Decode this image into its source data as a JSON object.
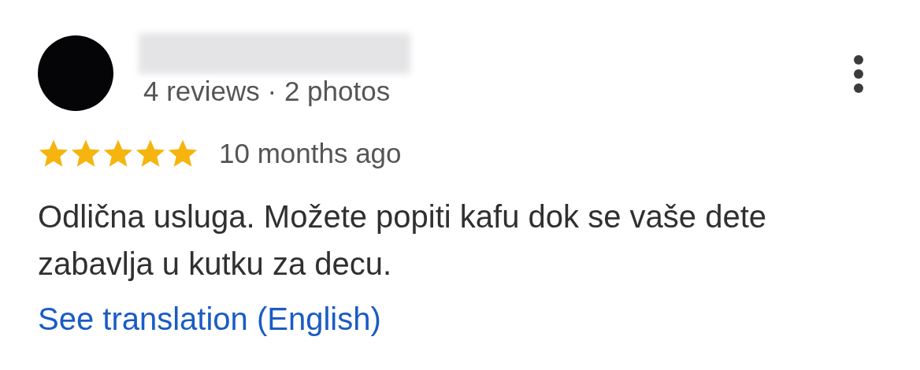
{
  "reviewer": {
    "meta": "4 reviews · 2 photos"
  },
  "review": {
    "stars": 5,
    "time": "10 months ago",
    "text": "Odlična usluga. Možete popiti kafu dok se vaše dete zabavlja u kutku za decu.",
    "translate_link": "See translation (English)"
  }
}
